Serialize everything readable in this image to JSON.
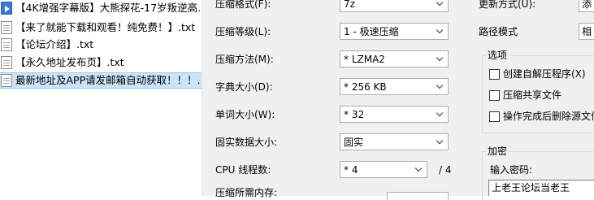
{
  "file_list": {
    "items": [
      {
        "icon": "video-file-icon",
        "name": "【4K增强字幕版】大熊探花-17岁叛逆高..."
      },
      {
        "icon": "text-file-icon",
        "name": "【来了就能下载和观看！纯免费！】.txt"
      },
      {
        "icon": "text-file-icon",
        "name": "【论坛介绍】.txt"
      },
      {
        "icon": "text-file-icon",
        "name": "【永久地址发布页】.txt"
      },
      {
        "icon": "text-file-icon",
        "name": "最新地址及APP请发邮箱自动获取！！！...."
      }
    ]
  },
  "compress": {
    "format_label": "压缩格式(F):",
    "format_value": "7z",
    "level_label": "压缩等级(L):",
    "level_value": "1 - 极速压缩",
    "method_label": "压缩方法(M):",
    "method_value": "* LZMA2",
    "dict_label": "字典大小(D):",
    "dict_value": "* 256 KB",
    "word_label": "单词大小(W):",
    "word_value": "* 32",
    "solid_label": "固实数据大小:",
    "solid_value": "固实",
    "threads_label": "CPU 线程数:",
    "threads_value": "* 4",
    "threads_max": "/ 4",
    "memory_label": "压缩所需内存:"
  },
  "right": {
    "update_label": "更新方式(U):",
    "update_value": "添",
    "path_label": "路径模式",
    "path_value": "相",
    "options_title": "选项",
    "opt_sfx": "创建自解压程序(X)",
    "opt_shared": "压缩共享文件",
    "opt_delete": "操作完成后删除源文件",
    "encrypt_title": "加密",
    "password_label": "输入密码:",
    "password_value": "上老王论坛当老王"
  }
}
